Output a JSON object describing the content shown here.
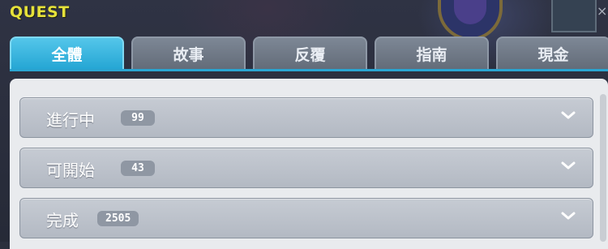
{
  "window": {
    "title": "QUEST",
    "close_label": "×"
  },
  "tabs": [
    {
      "label": "全體",
      "active": true
    },
    {
      "label": "故事",
      "active": false
    },
    {
      "label": "反覆",
      "active": false
    },
    {
      "label": "指南",
      "active": false
    },
    {
      "label": "現金",
      "active": false
    }
  ],
  "sections": [
    {
      "label": "進行中",
      "count": "99"
    },
    {
      "label": "可開始",
      "count": "43"
    },
    {
      "label": "完成",
      "count": "2505"
    }
  ],
  "colors": {
    "title": "#e6e23a",
    "tab_active": "#2aa8d6",
    "tab_inactive": "#6f7885",
    "row_bg": "#bcc2cb"
  }
}
